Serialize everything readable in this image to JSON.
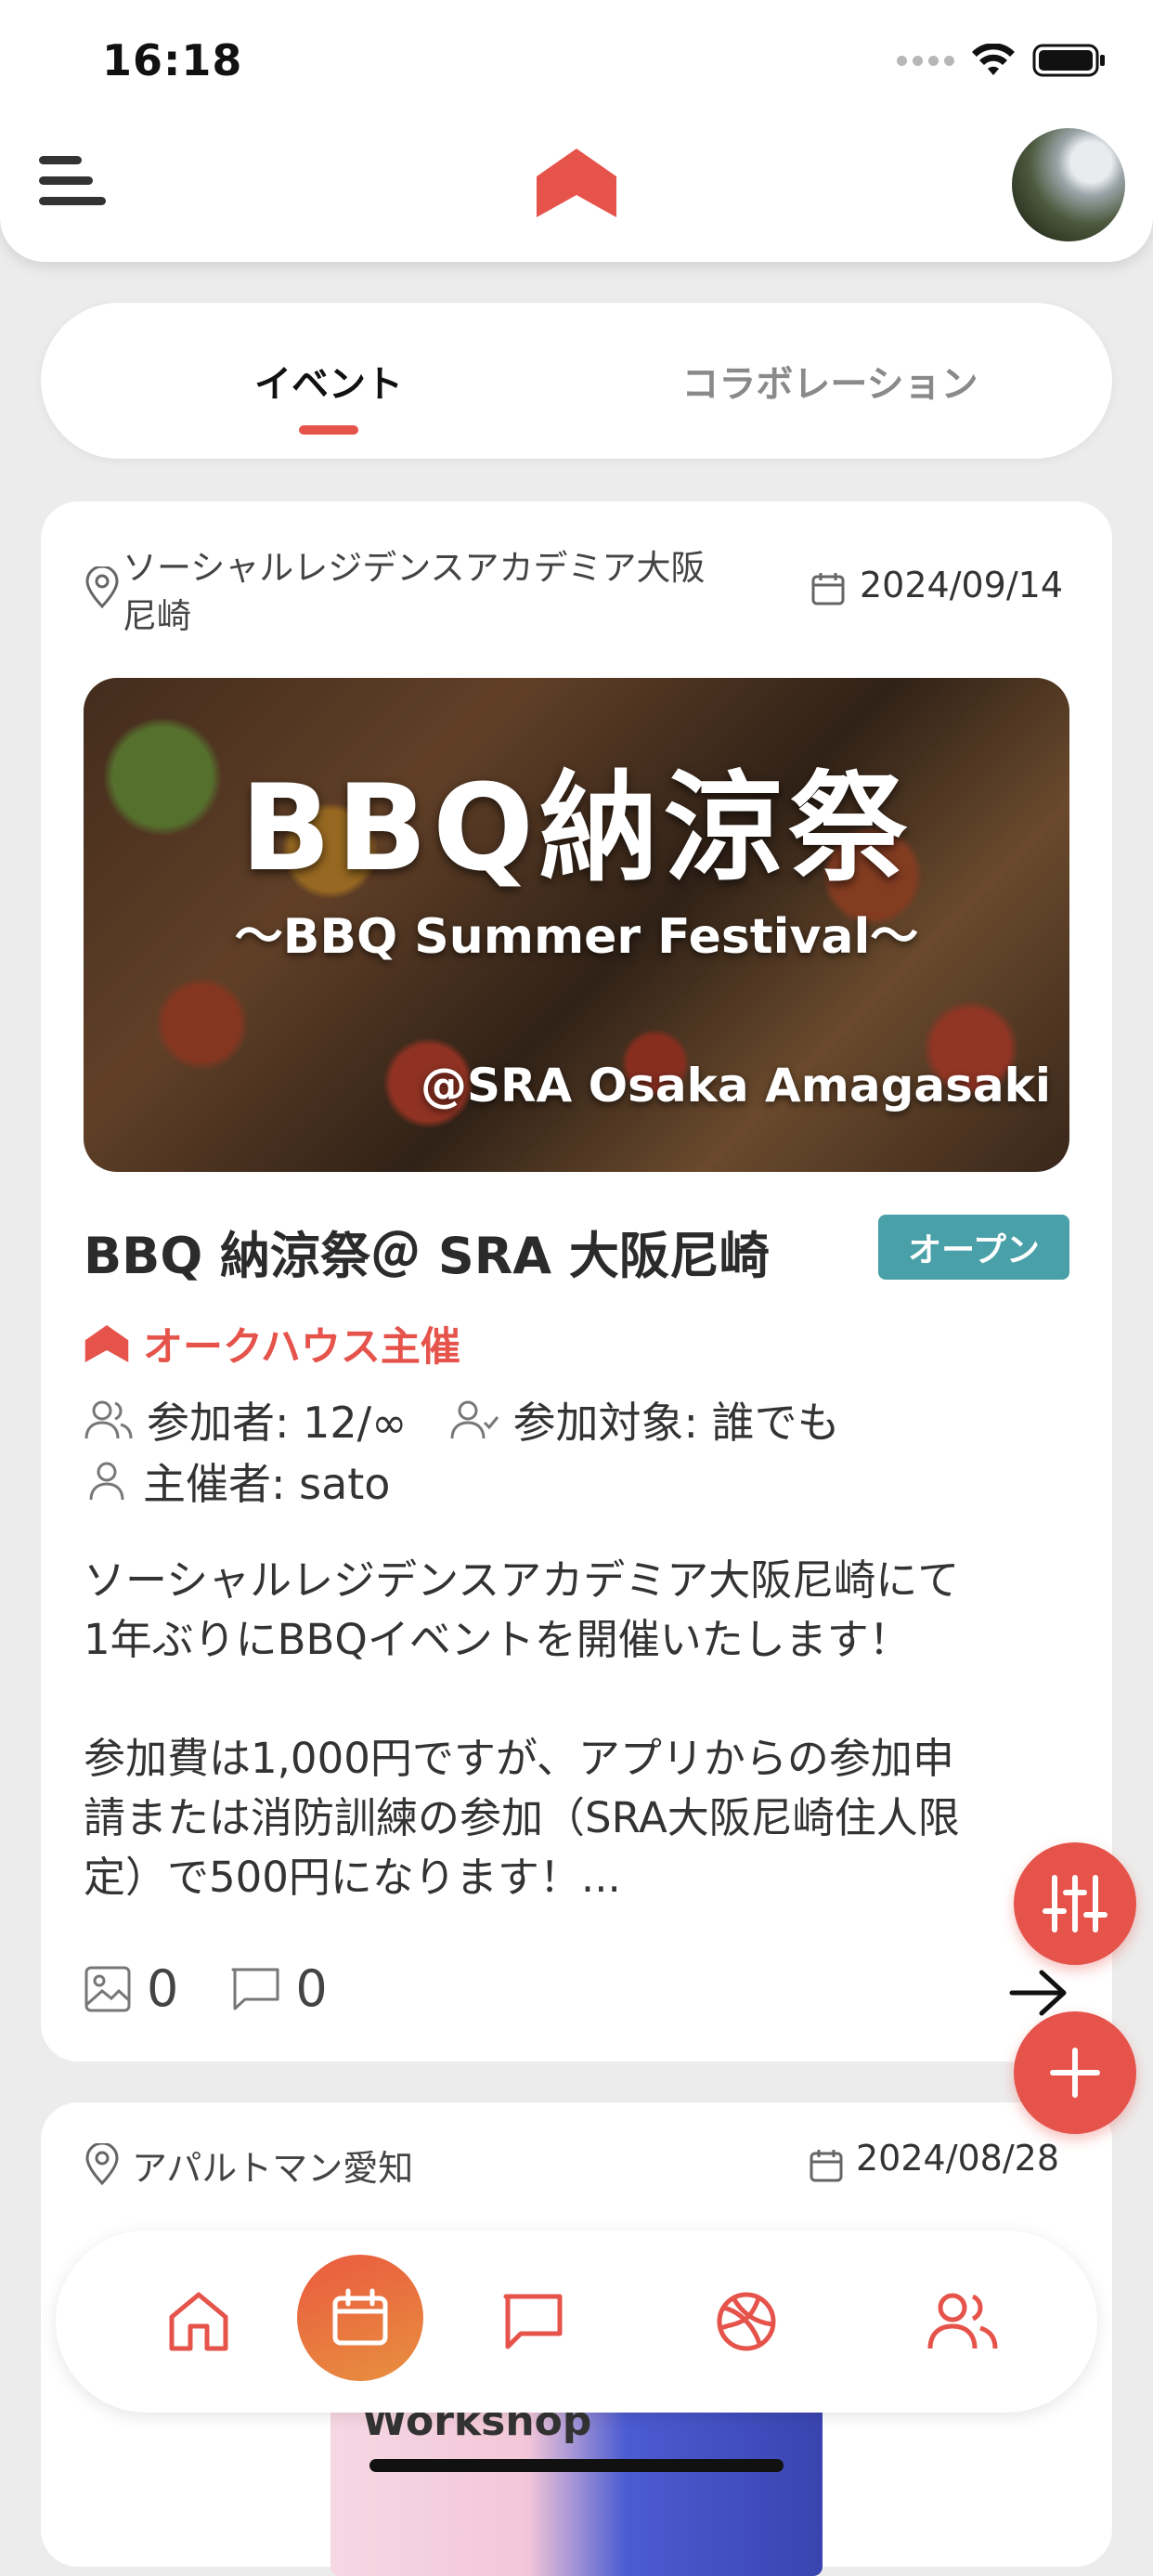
{
  "status_bar": {
    "time": "16:18"
  },
  "tabs": [
    {
      "label": "イベント",
      "active": true
    },
    {
      "label": "コラボレーション",
      "active": false
    }
  ],
  "colors": {
    "accent": "#e5534b",
    "badge": "#4aa0a8",
    "background": "#ececec"
  },
  "event": {
    "location_line1": "ソーシャルレジデンスアカデミア大阪",
    "location_line2": "尼崎",
    "date": "2024/09/14",
    "image_title": "BBQ納涼祭",
    "image_subtitle": "〜BBQ Summer Festival〜",
    "image_venue": "@SRA Osaka Amagasaki",
    "title": "BBQ 納涼祭＠ SRA 大阪尼崎",
    "status": "オープン",
    "host_label": "オークハウス主催",
    "participants": "参加者: 12/∞",
    "target": "参加対象: 誰でも",
    "organizer": "主催者: sato",
    "description_lines": [
      "ソーシャルレジデンスアカデミア大阪尼崎にて",
      "1年ぶりにBBQイベントを開催いたします！",
      "参加費は1,000円ですが、アプリからの参加申",
      "請または消防訓練の参加（SRA大阪尼崎住人限",
      "定）で500円になります！..."
    ],
    "photo_count": "0",
    "comment_count": "0"
  },
  "event2": {
    "location": "アパルトマン愛知",
    "date": "2024/08/28",
    "image_text": "Workshop"
  },
  "icons": {
    "menu": "menu-icon",
    "logo": "roof-logo-icon",
    "filter": "sliders-icon",
    "add": "plus-icon",
    "nav": [
      "home-icon",
      "calendar-icon",
      "chat-icon",
      "basketball-icon",
      "users-icon"
    ]
  }
}
